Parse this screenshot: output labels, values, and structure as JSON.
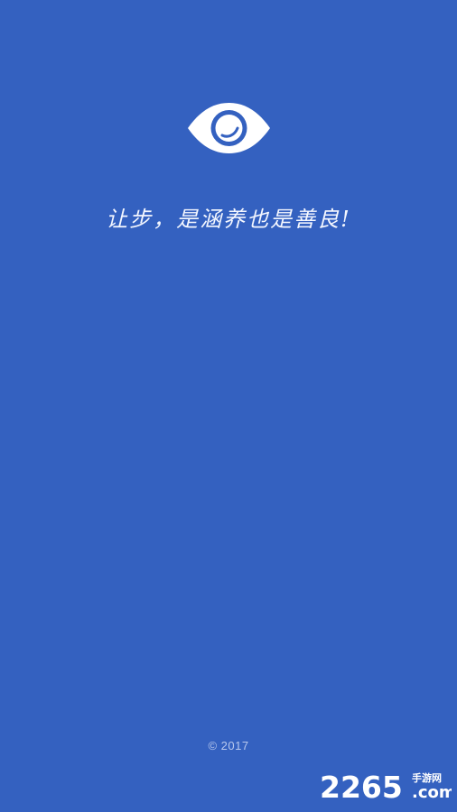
{
  "app": {
    "background_color": "#3461C0",
    "logo": {
      "icon": "eye-icon",
      "color": "#FFFFFF"
    },
    "slogan": "让步，是涵养也是善良!",
    "copyright": "© 2017"
  },
  "watermark": {
    "text": "2265手游网",
    "domain": ".com"
  }
}
